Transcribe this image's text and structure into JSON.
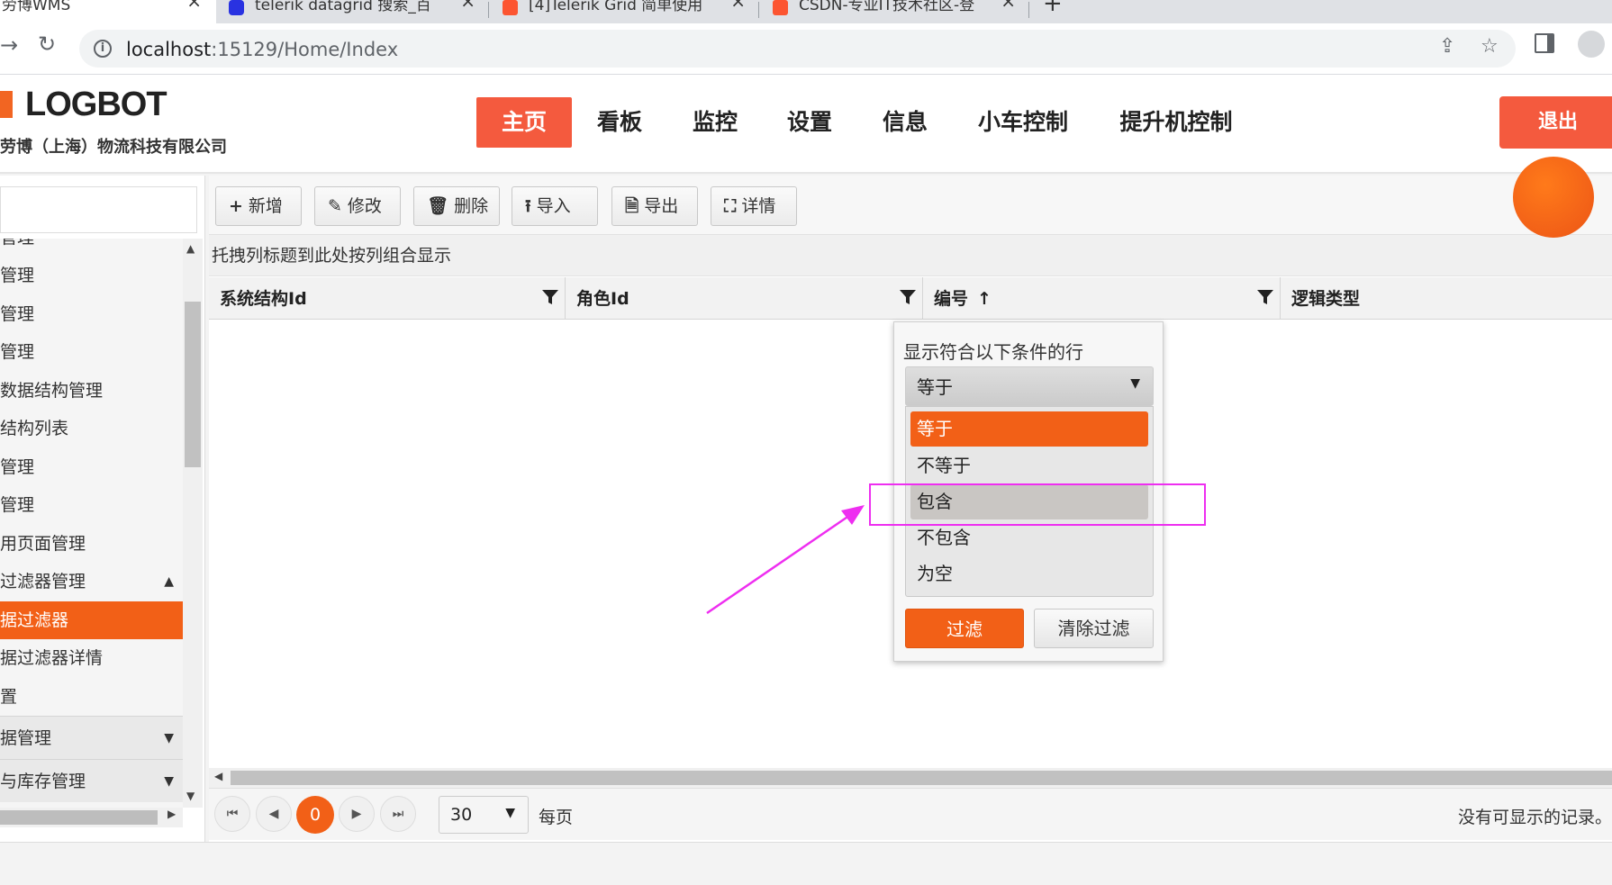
{
  "browser": {
    "tabs": [
      {
        "label": "劳博WMS",
        "favicon_color": "#f26522"
      },
      {
        "label": "telerik datagrid 搜索_百",
        "favicon_color": "#2932e1"
      },
      {
        "label": "[4]Telerik Grid 简单使用",
        "favicon_color": "#fc5531"
      },
      {
        "label": "CSDN-专业IT技术社区-登",
        "favicon_color": "#fc5531"
      }
    ],
    "url_host": "localhost",
    "url_path": ":15129/Home/Index"
  },
  "header": {
    "logo_text": "LOGBOT",
    "company": "劳博（上海）物流科技有限公司",
    "nav": [
      "主页",
      "看板",
      "监控",
      "设置",
      "信息",
      "小车控制",
      "提升机控制"
    ],
    "logout": "退出",
    "accent_color": "#f45a3e"
  },
  "sidebar": {
    "items": [
      {
        "label": "管理"
      },
      {
        "label": "管理"
      },
      {
        "label": "管理"
      },
      {
        "label": "管理"
      },
      {
        "label": "数据结构管理"
      },
      {
        "label": "结构列表"
      },
      {
        "label": "管理"
      },
      {
        "label": "管理"
      },
      {
        "label": "用页面管理"
      },
      {
        "label": "过滤器管理"
      },
      {
        "label": "据过滤器"
      },
      {
        "label": "据过滤器详情"
      },
      {
        "label": "置"
      },
      {
        "label": "据管理"
      },
      {
        "label": "与库存管理"
      }
    ]
  },
  "grid": {
    "toolbar": [
      {
        "icon": "plus-icon",
        "glyph": "+",
        "label": "新增"
      },
      {
        "icon": "pencil-icon",
        "glyph": "✎",
        "label": "修改"
      },
      {
        "icon": "trash-icon",
        "glyph": "🗑",
        "label": "删除"
      },
      {
        "icon": "upload-icon",
        "glyph": "⭱",
        "label": "导入"
      },
      {
        "icon": "excel-icon",
        "glyph": "🗎",
        "label": "导出"
      },
      {
        "icon": "expand-icon",
        "glyph": "⛶",
        "label": "详情"
      }
    ],
    "group_hint": "托拽列标题到此处按列组合显示",
    "columns": [
      {
        "title": "系统结构Id",
        "sort": ""
      },
      {
        "title": "角色Id",
        "sort": ""
      },
      {
        "title": "编号",
        "sort": "↑"
      },
      {
        "title": "逻辑类型",
        "sort": ""
      }
    ],
    "pager": {
      "page": "0",
      "page_size": "30",
      "per_page_label": "每页",
      "info": "没有可显示的记录。"
    }
  },
  "filter_popup": {
    "title": "显示符合以下条件的行",
    "selected": "等于",
    "options": [
      "等于",
      "不等于",
      "包含",
      "不包含",
      "为空"
    ],
    "filter_button": "过滤",
    "clear_button": "清除过滤"
  },
  "annotation": {
    "color": "#ee2ef0"
  }
}
